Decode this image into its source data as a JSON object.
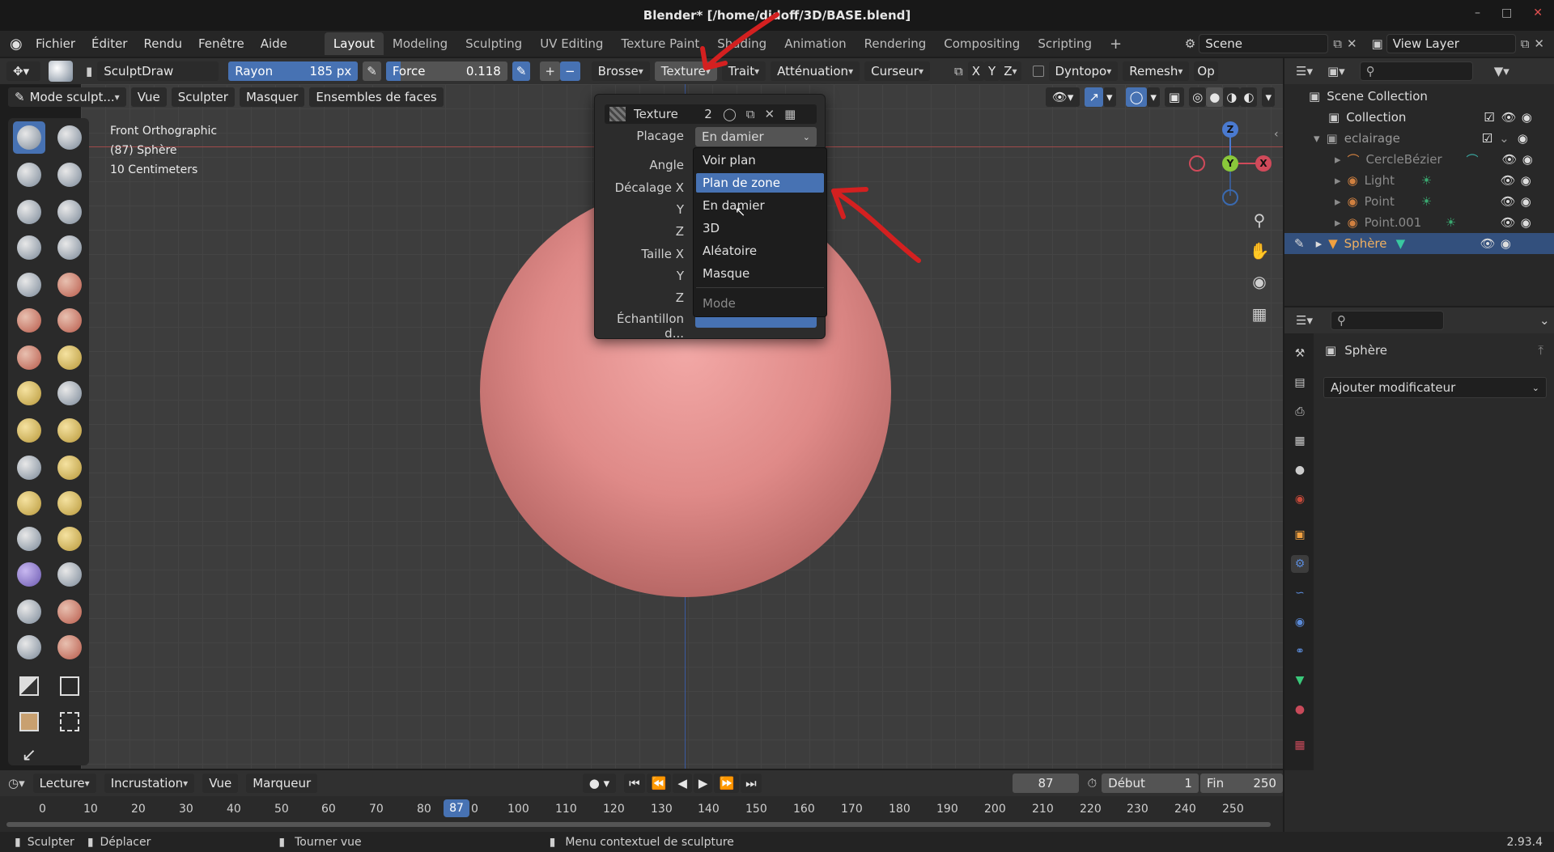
{
  "window": {
    "title": "Blender* [/home/didoff/3D/BASE.blend]"
  },
  "menu": {
    "items": [
      "Fichier",
      "Éditer",
      "Rendu",
      "Fenêtre",
      "Aide"
    ]
  },
  "workspaces": [
    "Layout",
    "Modeling",
    "Sculpting",
    "UV Editing",
    "Texture Paint",
    "Shading",
    "Animation",
    "Rendering",
    "Compositing",
    "Scripting"
  ],
  "scene": {
    "label": "Scene",
    "view_layer": "View Layer"
  },
  "tool_header": {
    "brush_name": "SculptDraw",
    "radius_label": "Rayon",
    "radius_value": "185 px",
    "strength_label": "Force",
    "strength_value": "0.118",
    "plus": "+",
    "minus": "−",
    "brush_menu": "Brosse",
    "texture_menu": "Texture",
    "stroke_menu": "Trait",
    "falloff_menu": "Atténuation",
    "cursor_menu": "Curseur",
    "axis_x": "X",
    "axis_y": "Y",
    "axis_z": "Z",
    "dyntopo": "Dyntopo",
    "remesh": "Remesh",
    "options": "Op"
  },
  "mode_header": {
    "mode": "Mode sculpt...",
    "items": [
      "Vue",
      "Sculpter",
      "Masquer",
      "Ensembles de faces"
    ]
  },
  "viewport_info": {
    "view": "Front Orthographic",
    "object": "(87) Sphère",
    "scale": "10 Centimeters"
  },
  "gizmo": {
    "x": "X",
    "y": "Y",
    "z": "Z"
  },
  "texture_popup": {
    "texture_name": "Texture",
    "user_count": "2",
    "placage_label": "Placage",
    "placage_value": "En damier",
    "angle_label": "Angle",
    "offset_x_label": "Décalage X",
    "y_label": "Y",
    "z_label": "Z",
    "size_x_label": "Taille X",
    "size_y_label": "Y",
    "size_z_label": "Z",
    "sample_label": "Échantillon d..."
  },
  "dropdown": {
    "options": [
      "Voir plan",
      "Plan de zone",
      "En damier",
      "3D",
      "Aléatoire",
      "Masque"
    ],
    "highlighted": "Plan de zone",
    "title": "Mode"
  },
  "outliner": {
    "rows": [
      {
        "label": "Scene Collection"
      },
      {
        "label": "Collection"
      },
      {
        "label": "eclairage"
      },
      {
        "label": "CercleBézier"
      },
      {
        "label": "Light"
      },
      {
        "label": "Point"
      },
      {
        "label": "Point.001"
      },
      {
        "label": "Sphère"
      }
    ]
  },
  "properties": {
    "object_name": "Sphère",
    "add_modifier": "Ajouter modificateur"
  },
  "timeline": {
    "playback": "Lecture",
    "keying": "Incrustation",
    "view": "Vue",
    "marker": "Marqueur",
    "current_frame": "87",
    "start_label": "Début",
    "start_value": "1",
    "end_label": "Fin",
    "end_value": "250",
    "ticks": [
      "0",
      "10",
      "20",
      "30",
      "40",
      "50",
      "60",
      "70",
      "80",
      "0",
      "100",
      "110",
      "120",
      "130",
      "140",
      "150",
      "160",
      "170",
      "180",
      "190",
      "200",
      "210",
      "220",
      "230",
      "240",
      "250"
    ],
    "playhead": "87"
  },
  "status": {
    "sculpt": "Sculpter",
    "move": "Déplacer",
    "rotate": "Tourner vue",
    "context": "Menu contextuel de sculpture",
    "version": "2.93.4"
  },
  "colors": {
    "accent": "#4772b3",
    "annotation": "#d42020",
    "sphere": "#df8a88"
  }
}
